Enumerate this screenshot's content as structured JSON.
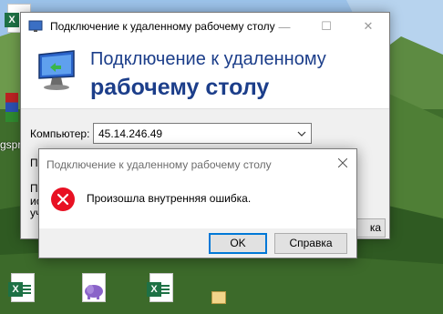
{
  "desktop": {
    "left_label": "gspr",
    "icons": [
      "excel-file-icon",
      "php-elephant-icon",
      "excel-file-icon"
    ]
  },
  "rdp_window": {
    "title": "Подключение к удаленному рабочему столу",
    "header_line1": "Подключение к удаленному",
    "header_line2": "рабочему столу",
    "computer_label": "Компьютер:",
    "computer_value": "45.14.246.49",
    "partial_p1": "П",
    "partial_p2": "П",
    "partial_p3": "ис",
    "partial_p4": "уч",
    "partial_button": "ка"
  },
  "error_dialog": {
    "title": "Подключение к удаленному рабочему столу",
    "message": "Произошла внутренняя ошибка.",
    "ok_label": "OK",
    "help_label": "Справка"
  },
  "colors": {
    "header_text": "#1c3e8a",
    "error_red": "#e81123",
    "focus_border": "#0078d7"
  }
}
